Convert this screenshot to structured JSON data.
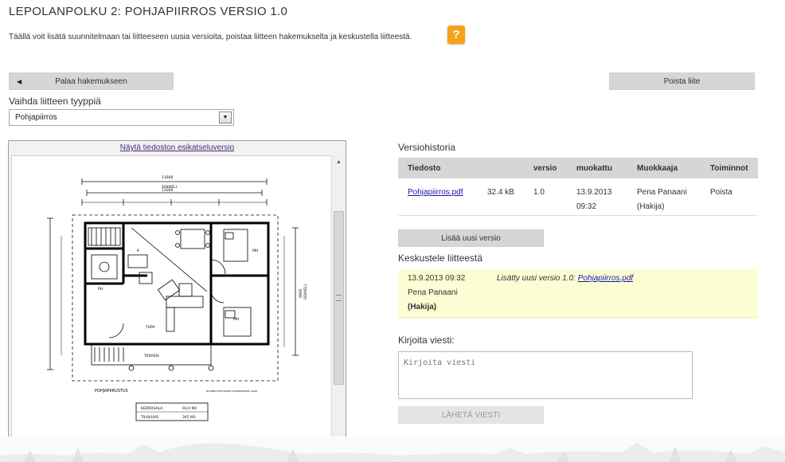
{
  "page": {
    "title": "LEPOLANPOLKU 2: POHJAPIIRROS VERSIO 1.0",
    "intro": "Täällä voit lisätä suunnitelmaan tai liitteeseen uusia versioita, poistaa liitteen hakemukselta ja keskustella liitteestä.",
    "help_label": "?"
  },
  "toolbar": {
    "back_arrow": "◀",
    "back_label": "Palaa hakemukseen",
    "delete_label": "Poista liite"
  },
  "attachment_type": {
    "label": "Vaihda liitteen tyyppiä",
    "selected": "Pohjapiirros",
    "drop_glyph": "▼"
  },
  "preview": {
    "link": "Näytä tiedoston esikatseluversio",
    "scroll_up": "▲",
    "drawing_labels": {
      "width_top": "11600",
      "sokkeli": "SOKKELI",
      "width_second": "11000",
      "k": "K",
      "mh1": "MH",
      "mh2": "MH",
      "tupa": "TUPA",
      "rh": "RH",
      "terassi": "TERASSI",
      "pohjapiirustus": "POHJAPIIRUSTUS",
      "side_dim": "9900",
      "side_label": "SOKKELI",
      "kerrosala": "KERROSALA",
      "kerrosala_val": "93,0 M2",
      "tilavuus": "TILAVUUS",
      "tilavuus_val": "345 M3",
      "note_line1": "HUOMIOI MUUTAMAT HUOMIOITAVAT ASIAT"
    }
  },
  "version_history": {
    "heading": "Versiohistoria",
    "columns": [
      "Tiedosto",
      "",
      "versio",
      "muokattu",
      "Muokkaaja",
      "Toiminnot"
    ],
    "rows": [
      {
        "file": "Pohjapiirros.pdf",
        "size": "32.4 kB",
        "version": "1.0",
        "modified_date": "13.9.2013",
        "modified_time": "09:32",
        "editor": "Pena Panaani",
        "editor_role": "(Hakija)",
        "action": "Poista"
      }
    ],
    "add_label": "Lisää uusi versio"
  },
  "discussion": {
    "heading": "Keskustele liitteestä",
    "comments": [
      {
        "date": "13.9.2013 09:32",
        "author": "Pena Panaani",
        "role": "(Hakija)",
        "message": "Lisätty uusi versio 1.0:",
        "link": "Pohjapiirros.pdf"
      }
    ],
    "write_label": "Kirjoita viesti:",
    "placeholder": "Kirjoita viesti",
    "send_label": "LÄHETÄ VIESTI"
  },
  "colors": {
    "accent": "#f7a21b",
    "button_grey": "#d6d6d6",
    "comment_bg": "#fdfdd3",
    "link": "#1a1aa8"
  }
}
